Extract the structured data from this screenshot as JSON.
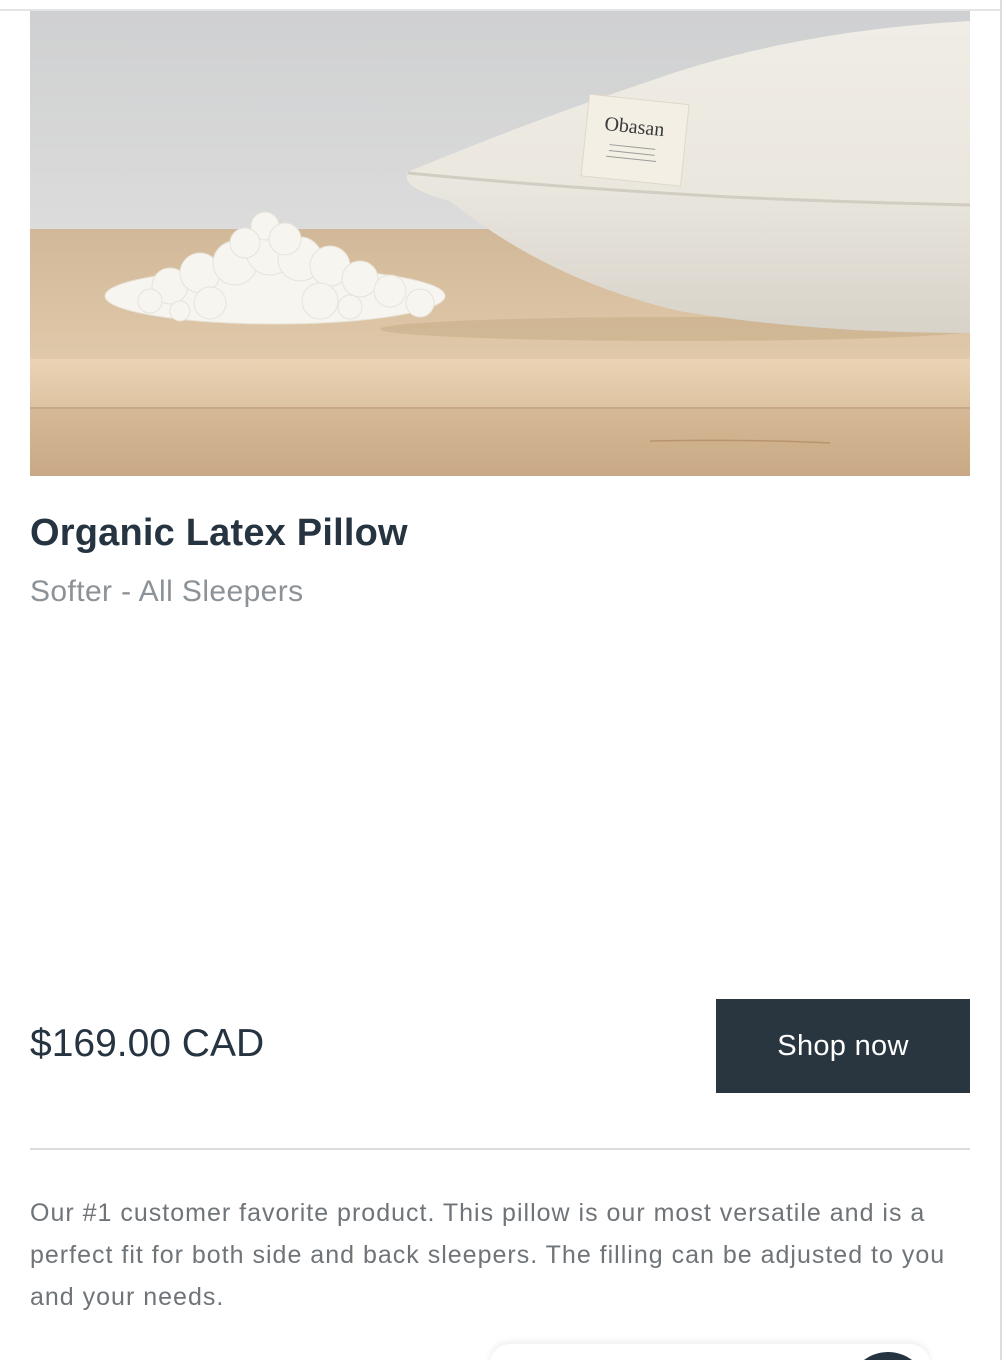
{
  "product": {
    "image_alt": "Obasan organic latex pillow next to shredded latex filling on a wooden table",
    "label_brand": "Obasan",
    "title": "Organic Latex Pillow",
    "subtitle": "Softer - All Sleepers",
    "price": "$169.00 CAD",
    "cta_label": "Shop now",
    "description": "Our #1 customer favorite product. This pillow is our most versatile and is a perfect fit for both side and back sleepers. The filling can be adjusted to you and your needs."
  },
  "colors": {
    "heading": "#263340",
    "subtitle": "#8b9298",
    "button_bg": "#29353f",
    "button_text": "#ffffff",
    "body_text": "#6f7479",
    "divider": "#dcdcdc"
  }
}
